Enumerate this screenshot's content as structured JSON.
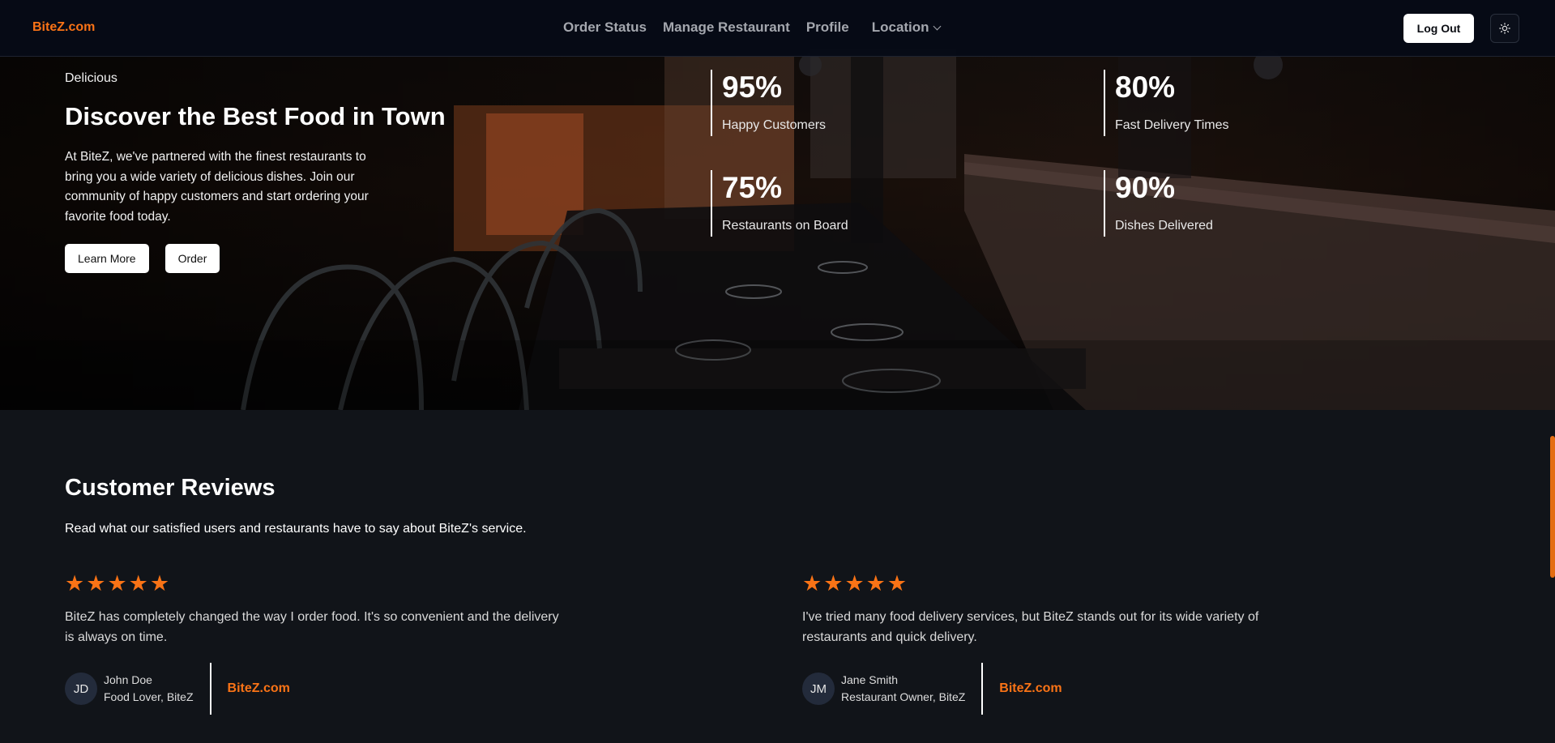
{
  "nav": {
    "brand": "BiteZ.com",
    "links": [
      "Order Status",
      "Manage Restaurant",
      "Profile"
    ],
    "location": "Location",
    "logout": "Log Out",
    "theme_icon": "sun-icon"
  },
  "hero": {
    "eyebrow": "Delicious",
    "title": "Discover the Best Food in Town",
    "description": "At BiteZ, we've partnered with the finest restaurants to bring you a wide variety of delicious dishes. Join our community of happy customers and start ordering your favorite food today.",
    "learn_more": "Learn More",
    "order": "Order",
    "stats": [
      {
        "value": "95%",
        "label": "Happy Customers"
      },
      {
        "value": "80%",
        "label": "Fast Delivery Times"
      },
      {
        "value": "75%",
        "label": "Restaurants on Board"
      },
      {
        "value": "90%",
        "label": "Dishes Delivered"
      }
    ]
  },
  "reviews": {
    "title": "Customer Reviews",
    "subtitle": "Read what our satisfied users and restaurants have to say about BiteZ's service.",
    "items": [
      {
        "rating": 5,
        "text": "BiteZ has completely changed the way I order food. It's so convenient and the delivery is always on time.",
        "initials": "JD",
        "name": "John Doe",
        "role": "Food Lover, BiteZ",
        "brand": "BiteZ.com"
      },
      {
        "rating": 5,
        "text": "I've tried many food delivery services, but BiteZ stands out for its wide variety of restaurants and quick delivery.",
        "initials": "JM",
        "name": "Jane Smith",
        "role": "Restaurant Owner, BiteZ",
        "brand": "BiteZ.com"
      }
    ]
  },
  "colors": {
    "accent": "#f97316",
    "background": "#111419",
    "navbar": "#060a16"
  }
}
